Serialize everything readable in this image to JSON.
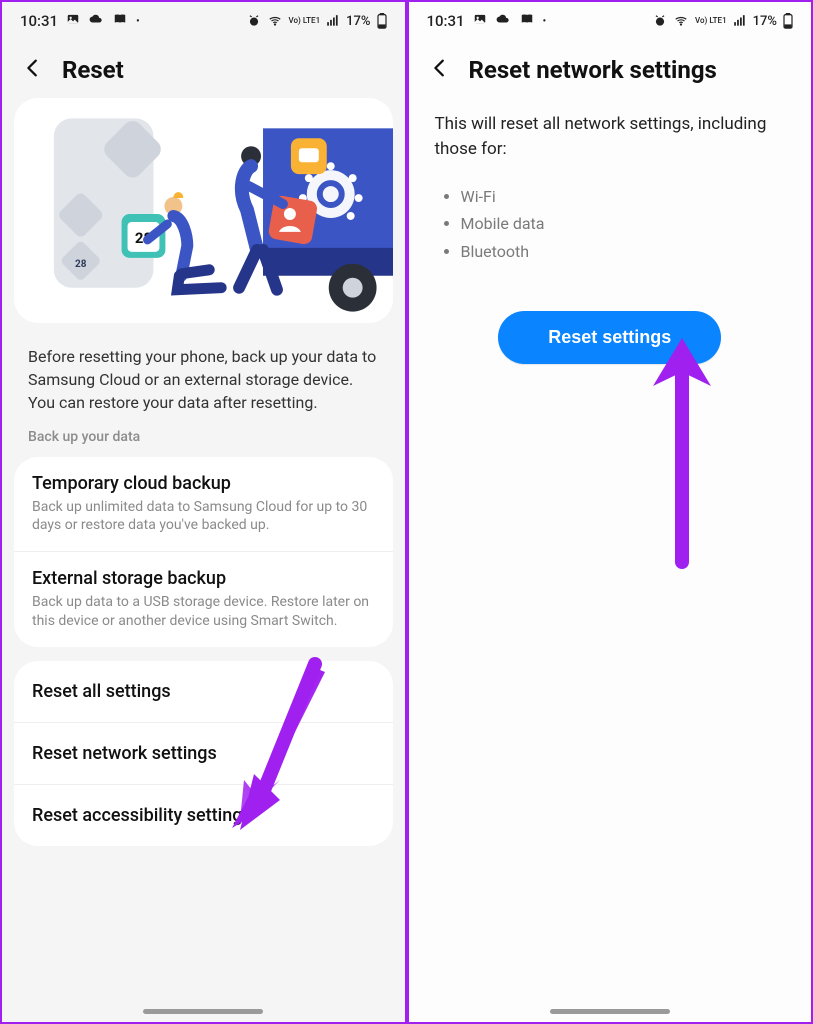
{
  "status": {
    "time": "10:31",
    "battery": "17%",
    "net_badge": "Vo) LTE1"
  },
  "left": {
    "title": "Reset",
    "desc": "Before resetting your phone, back up your data to Samsung Cloud or an external storage device. You can restore your data after resetting.",
    "backup_caption": "Back up your data",
    "backup": [
      {
        "title": "Temporary cloud backup",
        "sub": "Back up unlimited data to Samsung Cloud for up to 30 days or restore data you've backed up."
      },
      {
        "title": "External storage backup",
        "sub": "Back up data to a USB storage device. Restore later on this device or another device using Smart Switch."
      }
    ],
    "resets": [
      "Reset all settings",
      "Reset network settings",
      "Reset accessibility settings"
    ]
  },
  "right": {
    "title": "Reset network settings",
    "desc": "This will reset all network settings, including those for:",
    "bullets": [
      "Wi-Fi",
      "Mobile data",
      "Bluetooth"
    ],
    "btn": "Reset settings"
  },
  "illus": {
    "calendar_day": "28"
  }
}
